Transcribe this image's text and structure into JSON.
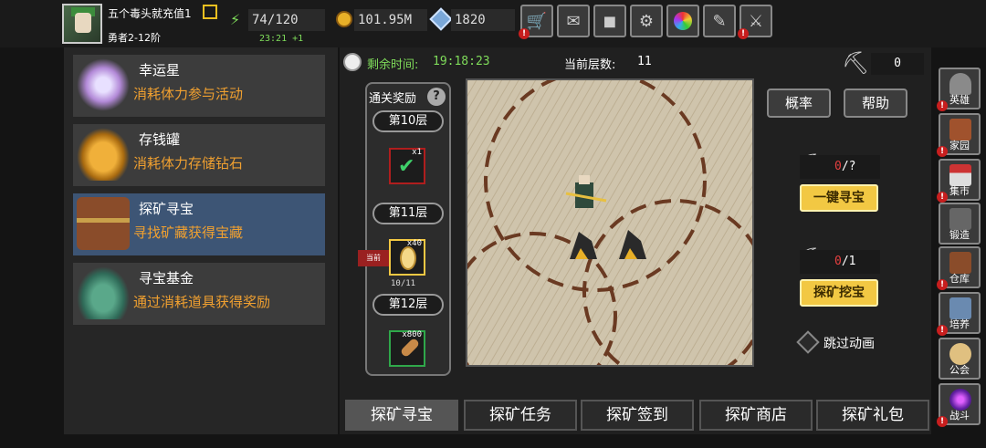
{
  "player": {
    "name": "五个毒头就充值1",
    "rank": "勇者2-12阶"
  },
  "stats": {
    "energy": "74/120",
    "energy_timer": "23:21 +1",
    "gold": "101.95M",
    "gems": "1820"
  },
  "top_icons": [
    "shop-cart-icon",
    "mail-icon",
    "gamepad-icon",
    "gear-icon",
    "color-wheel-icon",
    "feather-icon",
    "sword-icon"
  ],
  "left_menu": [
    {
      "title": "幸运星",
      "desc": "消耗体力参与活动"
    },
    {
      "title": "存钱罐",
      "desc": "消耗体力存储钻石"
    },
    {
      "title": "探矿寻宝",
      "desc": "寻找矿藏获得宝藏"
    },
    {
      "title": "寻宝基金",
      "desc": "通过消耗道具获得奖励"
    }
  ],
  "header": {
    "remaining_label": "剩余时间:",
    "remaining_time": "19:18:23",
    "floor_label": "当前层数:",
    "floor_value": "11",
    "pickaxe_count": "0"
  },
  "rewards": {
    "title": "通关奖励",
    "floor10": "第10层",
    "floor11": "第11层",
    "floor12": "第12层",
    "current_tag": "当前",
    "reward1_qty": "x1",
    "reward2_qty": "x40",
    "reward2_progress": "10/11",
    "reward3_qty": "x800"
  },
  "side": {
    "prob_label": "概率",
    "help_label": "帮助",
    "auto_count_a": "0",
    "auto_count_b": "/?",
    "auto_btn": "一键寻宝",
    "dig_count_a": "0",
    "dig_count_b": "/1",
    "dig_btn": "探矿挖宝",
    "skip_label": "跳过动画"
  },
  "tabs": [
    "探矿寻宝",
    "探矿任务",
    "探矿签到",
    "探矿商店",
    "探矿礼包"
  ],
  "right_nav": [
    "英雄",
    "家园",
    "集市",
    "锻造",
    "仓库",
    "培养",
    "公会",
    "战斗"
  ]
}
